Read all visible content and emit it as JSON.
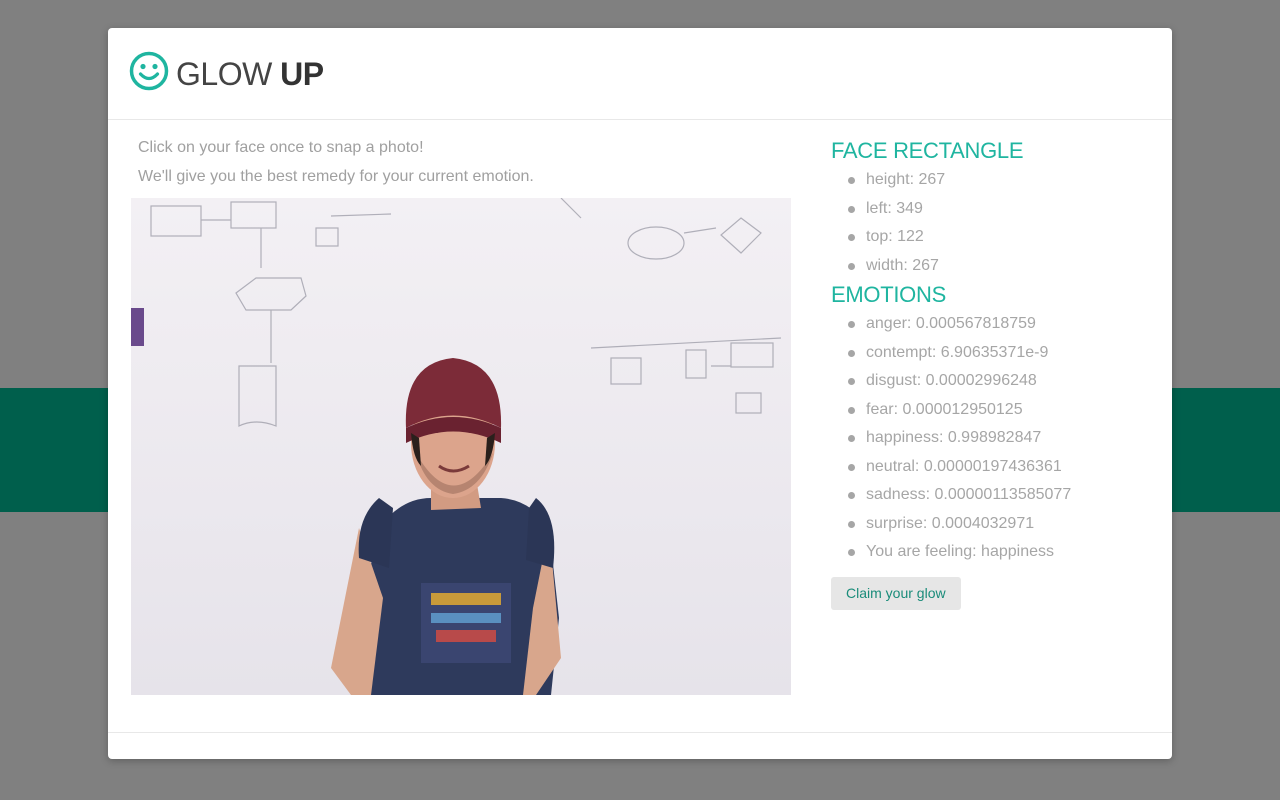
{
  "app": {
    "brand_light": "GLOW",
    "brand_bold": "UP",
    "logo_icon": "smiley-face-icon",
    "accent_color": "#1fb5a0",
    "band_color": "#005f4c"
  },
  "instructions": {
    "line1": "Click on your face once to snap a photo!",
    "line2": "We'll give you the best remedy for your current emotion."
  },
  "face_rectangle": {
    "title": "FACE RECTANGLE",
    "items": [
      {
        "label": "height: 267"
      },
      {
        "label": "left: 349"
      },
      {
        "label": "top: 122"
      },
      {
        "label": "width: 267"
      }
    ]
  },
  "emotions": {
    "title": "EMOTIONS",
    "items": [
      {
        "label": "anger: 0.000567818759"
      },
      {
        "label": "contempt: 6.90635371e-9"
      },
      {
        "label": "disgust: 0.00002996248"
      },
      {
        "label": "fear: 0.000012950125"
      },
      {
        "label": "happiness: 0.998982847"
      },
      {
        "label": "neutral: 0.00000197436361"
      },
      {
        "label": "sadness: 0.00000113585077"
      },
      {
        "label": "surprise: 0.0004032971"
      },
      {
        "label": "You are feeling: happiness"
      }
    ]
  },
  "actions": {
    "claim_label": "Claim your glow"
  }
}
